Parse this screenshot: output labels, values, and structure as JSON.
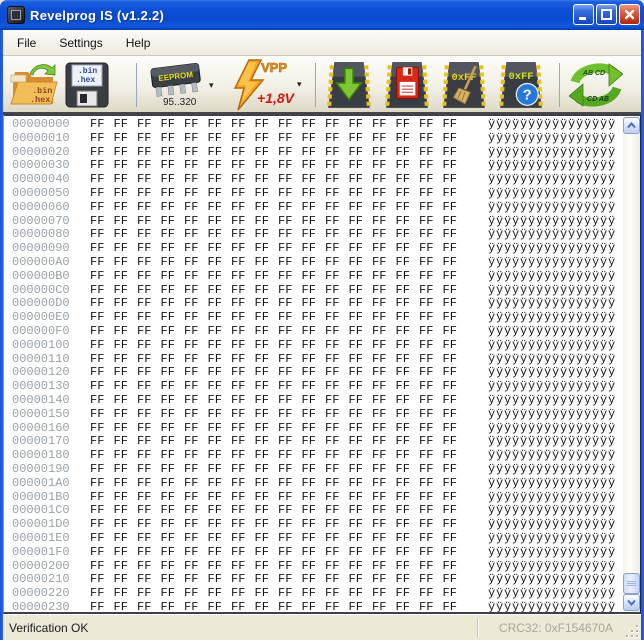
{
  "window": {
    "title": "Revelprog IS (v1.2.2)"
  },
  "menu": {
    "items": [
      {
        "label": "File"
      },
      {
        "label": "Settings"
      },
      {
        "label": "Help"
      }
    ]
  },
  "toolbar": {
    "open_button": {
      "line1": ".bin",
      "line2": ".hex"
    },
    "save_button": {
      "line1": ".bin",
      "line2": ".hex"
    },
    "eeprom_button": {
      "label": "EEPROM",
      "range": "95..320",
      "dropdown": "▾"
    },
    "vpp_button": {
      "label": "VPP",
      "voltage": "+1,8V",
      "dropdown": "▾"
    },
    "erase_button": {
      "label": "0xFF"
    },
    "blank_check_button": {
      "label": "0xFF",
      "question": "?"
    },
    "swap_button": {
      "top_label": "AB CD",
      "bottom_label": "CD AB"
    }
  },
  "hex_view": {
    "row_addresses": [
      "00000000",
      "00000010",
      "00000020",
      "00000030",
      "00000040",
      "00000050",
      "00000060",
      "00000070",
      "00000080",
      "00000090",
      "000000A0",
      "000000B0",
      "000000C0",
      "000000D0",
      "000000E0",
      "000000F0",
      "00000100",
      "00000110",
      "00000120",
      "00000130",
      "00000140",
      "00000150",
      "00000160",
      "00000170",
      "00000180",
      "00000190",
      "000001A0",
      "000001B0",
      "000001C0",
      "000001D0",
      "000001E0",
      "000001F0",
      "00000200",
      "00000210",
      "00000220",
      "00000230"
    ],
    "byte_value": "FF",
    "bytes_per_row": 16,
    "ascii_char": "ÿ",
    "ascii_per_row": 16
  },
  "status_bar": {
    "message": "Verification OK",
    "crc": "CRC32: 0xF154670A"
  },
  "colors": {
    "titlebar_blue": "#0d50d5",
    "chip_dark": "#2e3137",
    "pin_yellow": "#E8C020",
    "arrow_green": "#6FBF30",
    "vpp_red": "#D01818",
    "status_gray": "#a8a79b"
  }
}
